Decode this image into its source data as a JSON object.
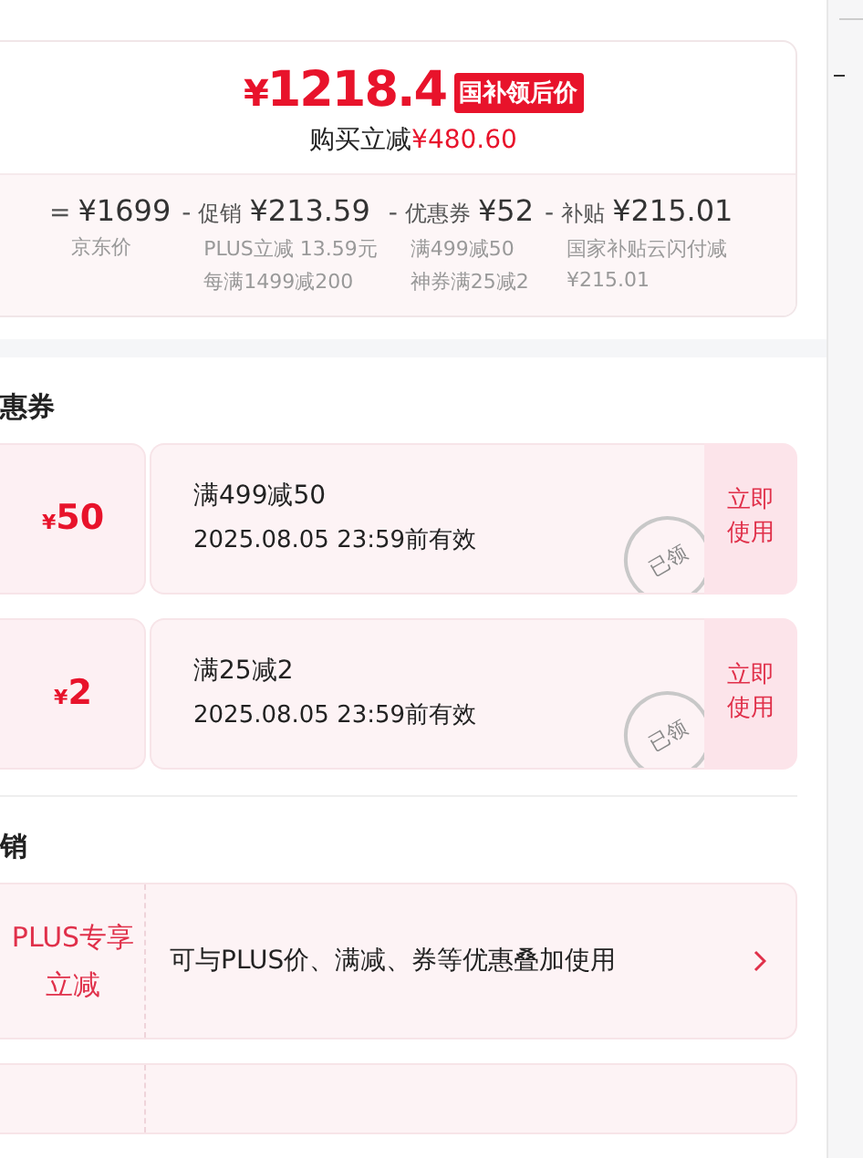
{
  "price_card": {
    "price_symbol": "¥",
    "price": "1218.4",
    "badge": "国补领后价",
    "saving_label": "购买立减",
    "saving_amount": "¥480.60",
    "breakdown": [
      {
        "operator": "=",
        "amount": "¥1699",
        "notes": [
          "京东价"
        ]
      },
      {
        "operator": "-",
        "label": "促销",
        "amount": "¥213.59",
        "notes": [
          "PLUS立减 13.59元",
          "每满1499减200"
        ]
      },
      {
        "operator": "-",
        "label": "优惠券",
        "amount": "¥52",
        "notes": [
          "满499减50",
          "神券满25减2"
        ]
      },
      {
        "operator": "-",
        "label": "补贴",
        "amount": "¥215.01",
        "notes": [
          "国家补贴云闪付减",
          "¥215.01"
        ]
      }
    ]
  },
  "coupon_section": {
    "title": "惠券",
    "coupons": [
      {
        "amount_symbol": "¥",
        "amount": "50",
        "title": "满499减50",
        "validity": "2025.08.05 23:59前有效",
        "stamp": "已领",
        "action": "立即使用"
      },
      {
        "amount_symbol": "¥",
        "amount": "2",
        "title": "满25减2",
        "validity": "2025.08.05 23:59前有效",
        "stamp": "已领",
        "action": "立即使用"
      }
    ]
  },
  "promo_section": {
    "title": "销",
    "promos": [
      {
        "tag": "PLUS专享立减",
        "text": "可与PLUS价、满减、券等优惠叠加使用"
      }
    ]
  }
}
